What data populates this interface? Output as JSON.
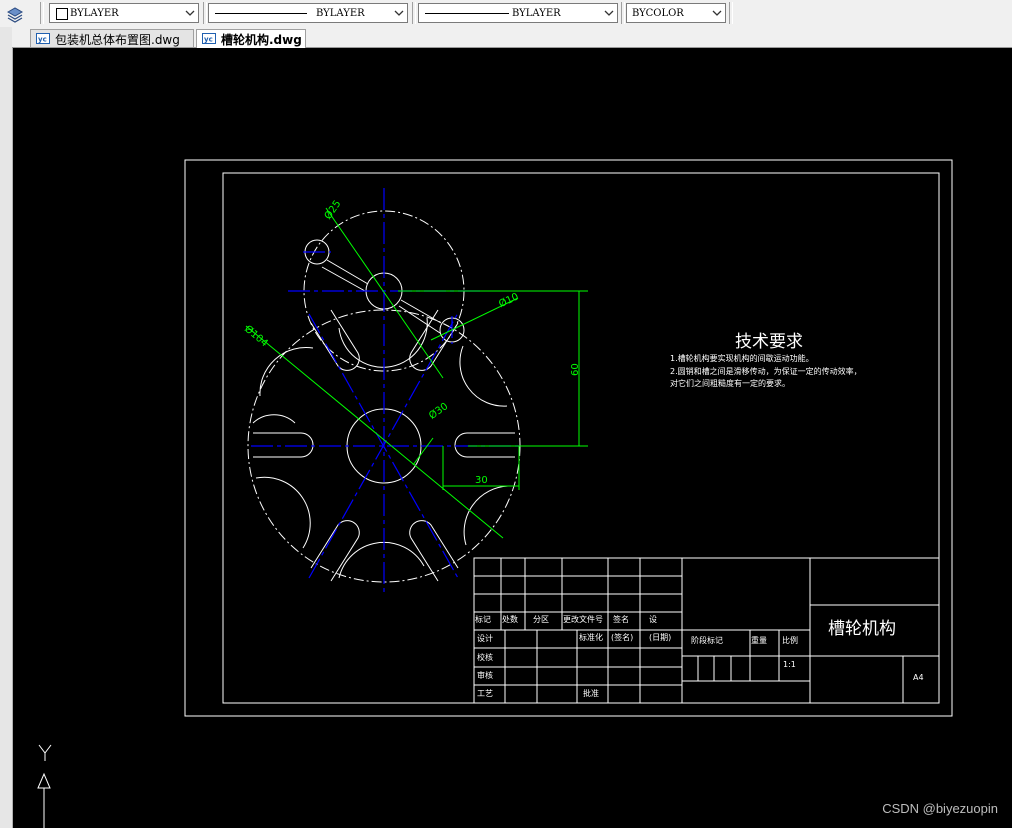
{
  "toolbar": {
    "color_combo": "BYLAYER",
    "linetype_combo": "BYLAYER",
    "lineweight_combo": "BYLAYER",
    "plotstyle_combo": "BYCOLOR"
  },
  "tabs": [
    {
      "label": "包装机总体布置图.dwg",
      "active": false
    },
    {
      "label": "槽轮机构.dwg",
      "active": true
    }
  ],
  "drawing": {
    "dimensions": {
      "d25": "Ø25",
      "d10": "Ø10",
      "d104": "Ø104",
      "d30": "Ø30",
      "dim60": "60",
      "dim30": "30"
    },
    "tech": {
      "title": "技术要求",
      "line1": "1.槽轮机构要实现机构的间歇运动功能。",
      "line2": "2.圆销和槽之间是滑移传动，为保证一定的传动效率，",
      "line3": "对它们之间粗糙度有一定的要求。"
    },
    "titleblock": {
      "name": "槽轮机构",
      "biaoji": "标记",
      "chushu": "处数",
      "fenqu": "分区",
      "gengai": "更改文件号",
      "qianming": "签名",
      "she": "设",
      "sheji": "设计",
      "biaozhunhua": "标准化",
      "qianming2": "(签名)",
      "riqi": "(日期)",
      "jieduan": "阶段标记",
      "zhongliang": "重量",
      "bili": "比例",
      "scale": "1:1",
      "jiaohe": "校核",
      "shenhe": "审核",
      "gongyi": "工艺",
      "pizhun": "批准",
      "sheet": "A4"
    }
  },
  "ucs": {
    "y_label": "Y"
  },
  "watermark": "CSDN @biyezuopin",
  "colors": {
    "canvas": "#000000",
    "frame": "#ffffff",
    "centerline": "#0000ff",
    "dimension": "#00ff00"
  }
}
